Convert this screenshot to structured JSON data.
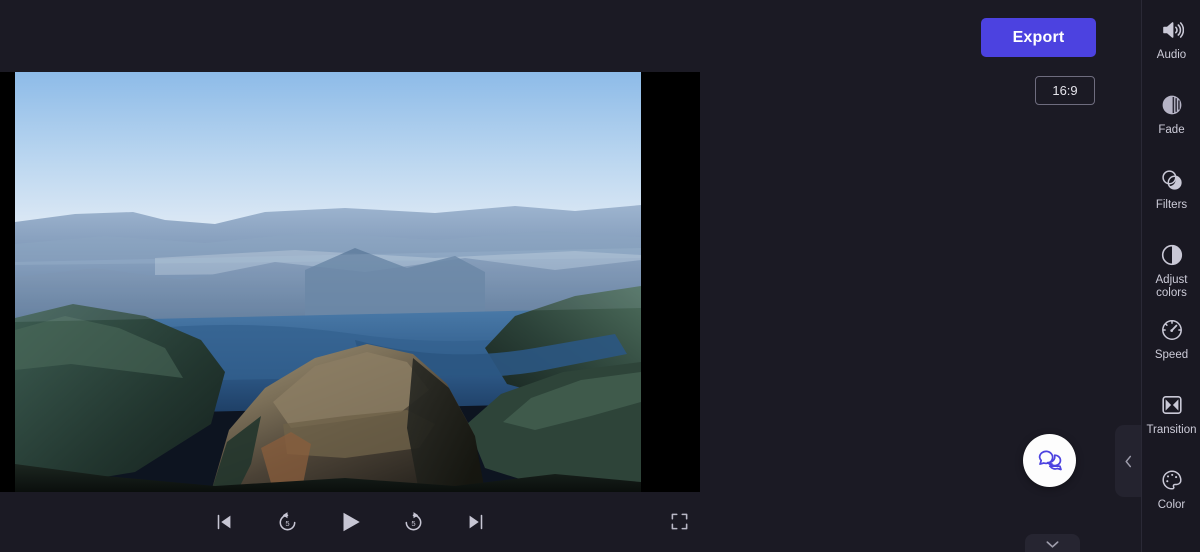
{
  "app": {
    "background_color": "#1b1a24",
    "accent_color": "#4c42e0"
  },
  "toolbar": {
    "export_label": "Export",
    "aspect_ratio_label": "16:9"
  },
  "preview": {
    "canvas_background": "#000000",
    "media_description": "Aerial view of Blyde River Canyon with a winding blue river between forested mountains and a rocky peak",
    "sky_color": "#b8d4ef",
    "water_color": "#2d5d8c",
    "ridge_color": "#6b86ad"
  },
  "playback": {
    "controls": [
      {
        "name": "skip-to-start",
        "label": "Skip to start"
      },
      {
        "name": "rewind-5-seconds",
        "label": "Back 5 seconds",
        "seconds": "5"
      },
      {
        "name": "play",
        "label": "Play"
      },
      {
        "name": "forward-5-seconds",
        "label": "Forward 5 seconds",
        "seconds": "5"
      },
      {
        "name": "skip-to-end",
        "label": "Skip to end"
      }
    ],
    "fullscreen_label": "Fullscreen"
  },
  "floating": {
    "chat_label": "Help and feedback",
    "collapse_label": "Collapse panel",
    "expand_down_label": "Show timeline"
  },
  "sidebar": {
    "items": [
      {
        "icon": "audio-icon",
        "label": "Audio"
      },
      {
        "icon": "fade-icon",
        "label": "Fade"
      },
      {
        "icon": "filters-icon",
        "label": "Filters"
      },
      {
        "icon": "adjust-colors-icon",
        "label": "Adjust\ncolors"
      },
      {
        "icon": "speed-icon",
        "label": "Speed"
      },
      {
        "icon": "transition-icon",
        "label": "Transition"
      },
      {
        "icon": "color-icon",
        "label": "Color"
      }
    ]
  }
}
